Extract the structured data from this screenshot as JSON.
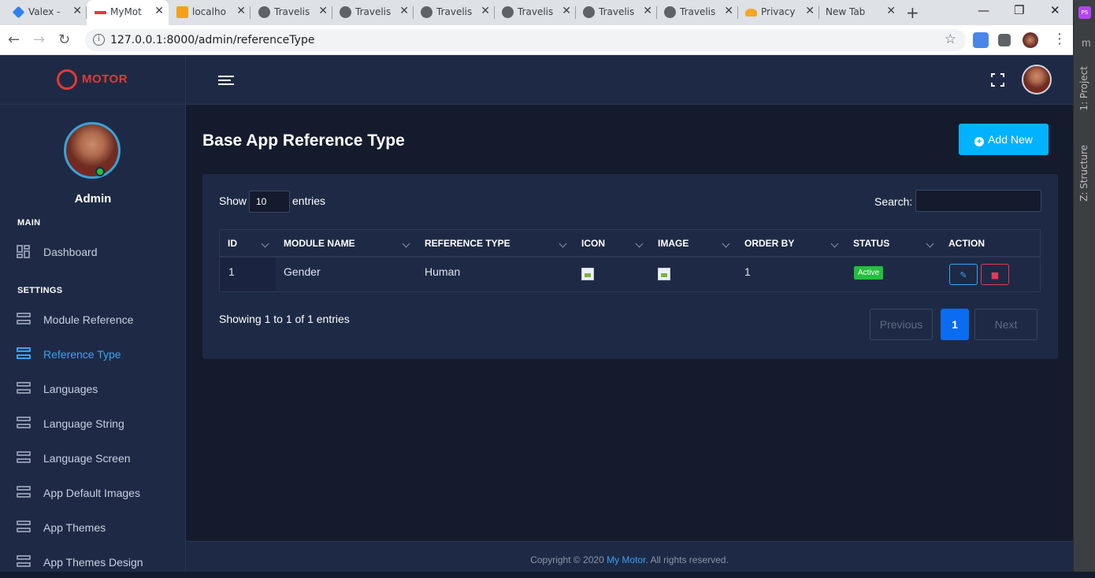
{
  "browser": {
    "tabs": [
      {
        "label": "Valex -"
      },
      {
        "label": "MyMot"
      },
      {
        "label": "localho"
      },
      {
        "label": "Travelis"
      },
      {
        "label": "Travelis"
      },
      {
        "label": "Travelis"
      },
      {
        "label": "Travelis"
      },
      {
        "label": "Travelis"
      },
      {
        "label": "Travelis"
      },
      {
        "label": "Privacy"
      },
      {
        "label": "New Tab"
      }
    ],
    "url": "127.0.0.1:8000/admin/referenceType"
  },
  "ide_panel": {
    "project_label": "1: Project",
    "structure_label": "Z: Structure",
    "badge": "PS",
    "m": "m"
  },
  "brand": {
    "name": "MOTOR"
  },
  "sidebar": {
    "user_name": "Admin",
    "sections": [
      {
        "title": "MAIN"
      },
      {
        "title": "SETTINGS"
      }
    ],
    "main_items": [
      {
        "label": "Dashboard"
      }
    ],
    "settings_items": [
      {
        "label": "Module Reference"
      },
      {
        "label": "Reference Type"
      },
      {
        "label": "Languages"
      },
      {
        "label": "Language String"
      },
      {
        "label": "Language Screen"
      },
      {
        "label": "App Default Images"
      },
      {
        "label": "App Themes"
      },
      {
        "label": "App Themes Design"
      }
    ]
  },
  "page": {
    "title": "Base App Reference Type",
    "add_button": "Add New",
    "show_label": "Show",
    "page_size": "10",
    "entries_label": "entries",
    "search_label": "Search:",
    "columns": [
      "ID",
      "MODULE NAME",
      "REFERENCE TYPE",
      "ICON",
      "IMAGE",
      "ORDER BY",
      "STATUS",
      "ACTION"
    ],
    "rows": [
      {
        "id": "1",
        "module_name": "Gender",
        "reference_type": "Human",
        "order_by": "1",
        "status": "Active"
      }
    ],
    "info": "Showing 1 to 1 of 1 entries",
    "pagination": {
      "previous": "Previous",
      "current": "1",
      "next": "Next"
    }
  },
  "footer": {
    "prefix": "Copyright © 2020 ",
    "brand": "My Motor",
    "suffix": ". All rights reserved."
  },
  "colors": {
    "accent": "#00b2ff",
    "active_link": "#38a3f5",
    "status_active": "#22c03c",
    "delete": "#e53955"
  }
}
